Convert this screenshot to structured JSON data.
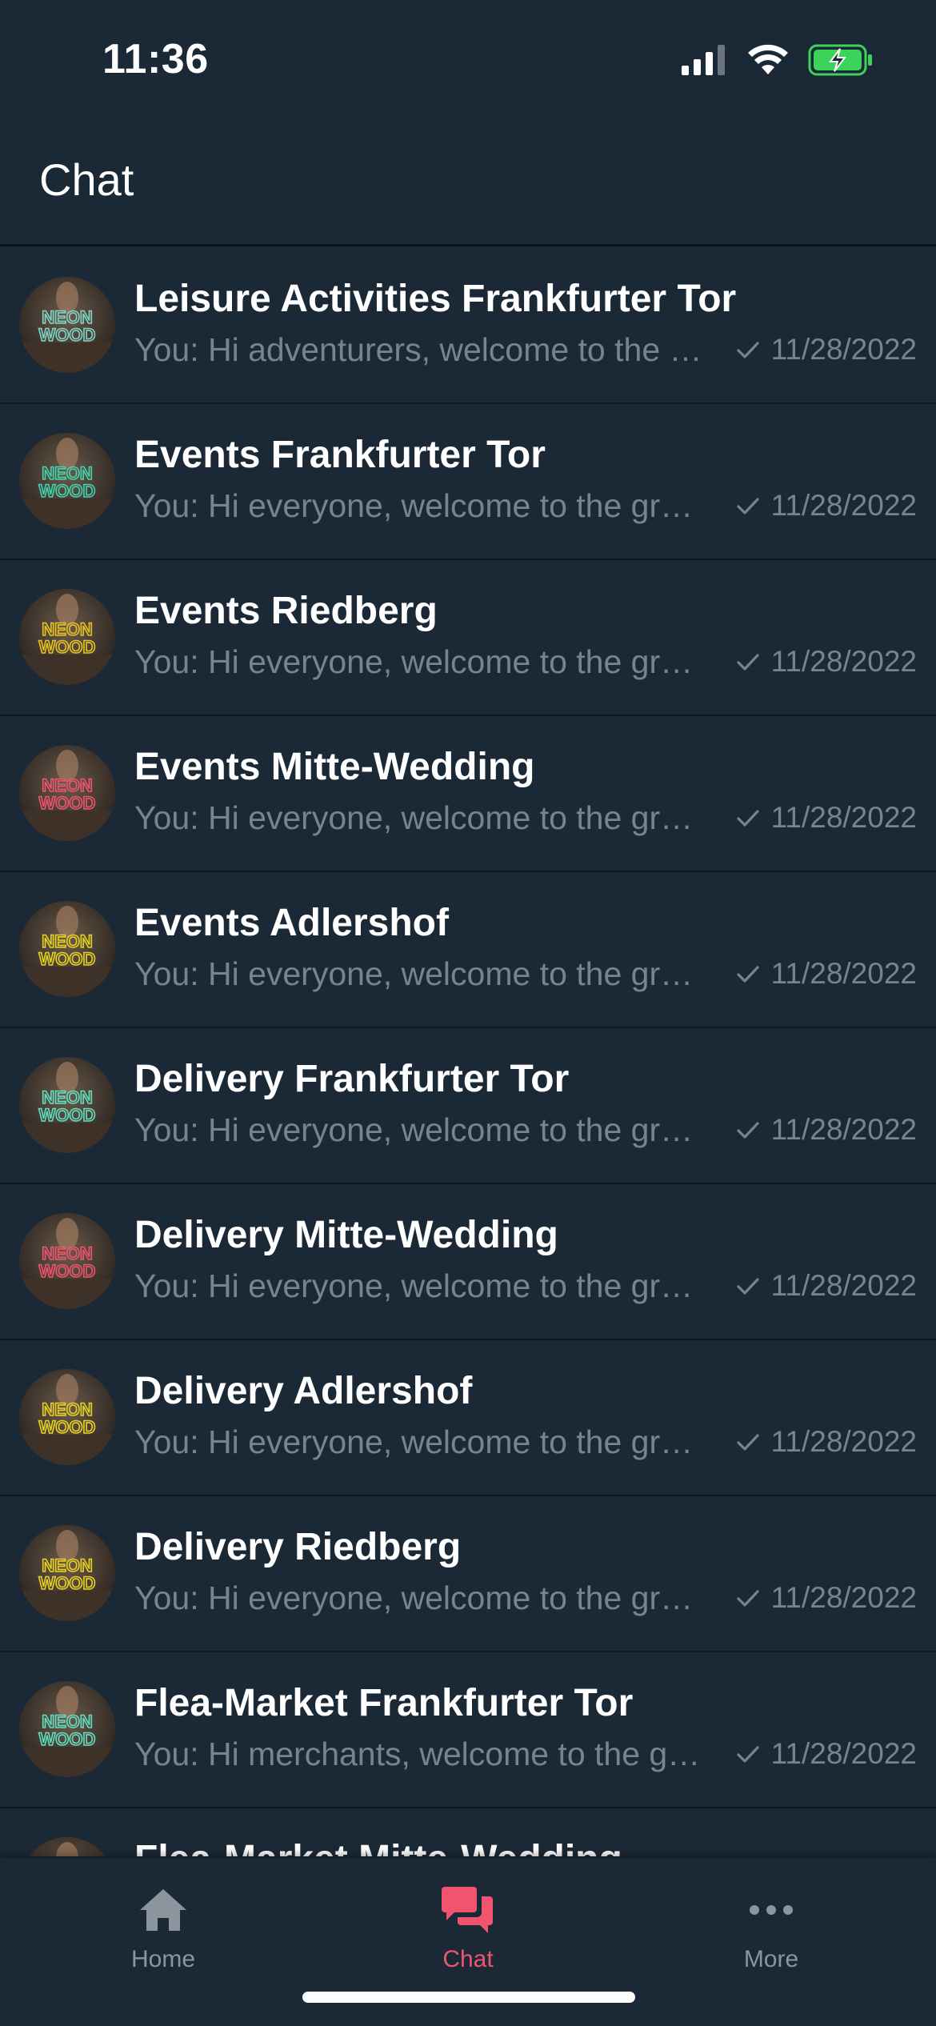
{
  "status_bar": {
    "time": "11:36"
  },
  "header": {
    "title": "Chat"
  },
  "colors": {
    "background": "#1b2937",
    "accent": "#f0546f",
    "muted_text": "#7a838c",
    "battery_green": "#3bd35a"
  },
  "chats": [
    {
      "title": "Leisure Activities Frankfurter Tor",
      "preview": "You: Hi adventurers,  welcome to the group",
      "date": "11/28/2022",
      "avatar_color": "#7fd6c8"
    },
    {
      "title": "Events Frankfurter Tor",
      "preview": "You: Hi everyone,  welcome to the group",
      "date": "11/28/2022",
      "avatar_color": "#3fd6b2"
    },
    {
      "title": "Events Riedberg",
      "preview": "You: Hi everyone,  welcome to the group",
      "date": "11/28/2022",
      "avatar_color": "#e8c21f"
    },
    {
      "title": "Events Mitte-Wedding",
      "preview": "You: Hi everyone,  welcome to the group",
      "date": "11/28/2022",
      "avatar_color": "#f0546f"
    },
    {
      "title": "Events Adlershof",
      "preview": "You: Hi everyone,  welcome to the group",
      "date": "11/28/2022",
      "avatar_color": "#e8d21f"
    },
    {
      "title": "Delivery Frankfurter Tor",
      "preview": "You: Hi everyone,  welcome to the group",
      "date": "11/28/2022",
      "avatar_color": "#5fe0c0"
    },
    {
      "title": "Delivery Mitte-Wedding",
      "preview": "You: Hi everyone,  welcome to the group",
      "date": "11/28/2022",
      "avatar_color": "#f0546f"
    },
    {
      "title": "Delivery Adlershof",
      "preview": "You: Hi everyone,  welcome to the group",
      "date": "11/28/2022",
      "avatar_color": "#e8d21f"
    },
    {
      "title": "Delivery Riedberg",
      "preview": "You: Hi everyone,  welcome to the group",
      "date": "11/28/2022",
      "avatar_color": "#e8d21f"
    },
    {
      "title": "Flea-Market Frankfurter Tor",
      "preview": "You: Hi merchants,  welcome to the group",
      "date": "11/28/2022",
      "avatar_color": "#5fe0c0"
    },
    {
      "title": "Flea-Market Mitte-Wedding",
      "preview": "",
      "date": "",
      "avatar_color": "#f0546f"
    }
  ],
  "tabs": [
    {
      "label": "Home",
      "icon": "home-icon",
      "active": false
    },
    {
      "label": "Chat",
      "icon": "chat-icon",
      "active": true
    },
    {
      "label": "More",
      "icon": "more-icon",
      "active": false
    }
  ]
}
